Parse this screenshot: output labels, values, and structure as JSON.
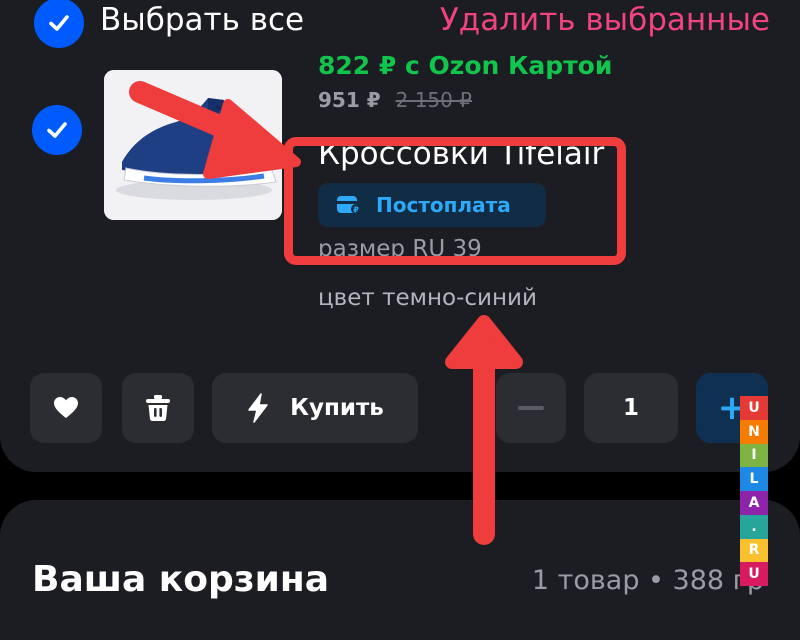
{
  "header": {
    "select_all_label": "Выбрать все",
    "delete_selected_label": "Удалить выбранные"
  },
  "product": {
    "price_ozon_card": "822 ₽ с Ozon Картой",
    "price_current": "951 ₽",
    "price_old": "2 150 ₽",
    "title": "Кроссовки Tifelair",
    "badge_label": "Постоплата",
    "size_text": "размер RU 39",
    "color_text": "цвет темно-синий",
    "selected": true
  },
  "actions": {
    "buy_label": "Купить",
    "quantity": "1",
    "minus_label": "−",
    "plus_label": "+"
  },
  "cart": {
    "title": "Ваша корзина",
    "summary": "1 товар • 388 гр"
  },
  "watermark": {
    "letters": [
      "U",
      "N",
      "I",
      "L",
      "A",
      ".",
      "R",
      "U"
    ],
    "colors": [
      "#e53935",
      "#f57c00",
      "#7cb342",
      "#1e88e5",
      "#8e24aa",
      "#26a69a",
      "#fbc02d",
      "#d81b60"
    ]
  },
  "theme": {
    "accent": "#005bff",
    "danger": "#f1437e",
    "green_price": "#10c44c",
    "badge_text": "#2ea8f8",
    "annotation_red": "#ef3c3c"
  }
}
